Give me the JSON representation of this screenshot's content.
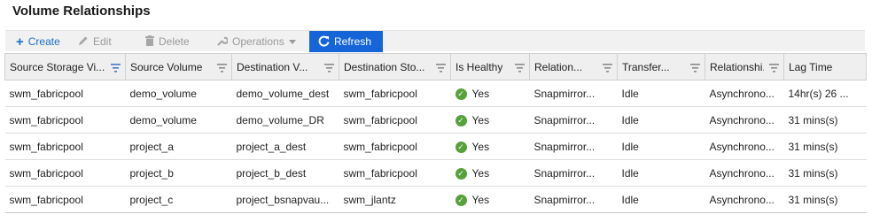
{
  "page": {
    "title": "Volume Relationships"
  },
  "toolbar": {
    "create_label": "Create",
    "edit_label": "Edit",
    "delete_label": "Delete",
    "operations_label": "Operations",
    "refresh_label": "Refresh"
  },
  "table": {
    "columns": [
      "Source Storage Vi...",
      "Source Volume",
      "Destination V...",
      "Destination Sto...",
      "Is Healthy",
      "Relation...",
      "Transfer...",
      "Relationshi...",
      "Lag Time"
    ],
    "rows": [
      [
        "swm_fabricpool",
        "demo_volume",
        "demo_volume_dest",
        "swm_fabricpool",
        "Yes",
        "Snapmirror...",
        "Idle",
        "Asynchrono...",
        "14hr(s) 26 ..."
      ],
      [
        "swm_fabricpool",
        "demo_volume",
        "demo_volume_DR",
        "swm_fabricpool",
        "Yes",
        "Snapmirror...",
        "Idle",
        "Asynchrono...",
        "31 mins(s)"
      ],
      [
        "swm_fabricpool",
        "project_a",
        "project_a_dest",
        "swm_fabricpool",
        "Yes",
        "Snapmirror...",
        "Idle",
        "Asynchrono...",
        "31 mins(s)"
      ],
      [
        "swm_fabricpool",
        "project_b",
        "project_b_dest",
        "swm_fabricpool",
        "Yes",
        "Snapmirror...",
        "Idle",
        "Asynchrono...",
        "31 mins(s)"
      ],
      [
        "swm_fabricpool",
        "project_c",
        "project_bsnapvau...",
        "swm_jlantz",
        "Yes",
        "Snapmirror...",
        "Idle",
        "Asynchrono...",
        "31 mins(s)"
      ]
    ]
  },
  "colors": {
    "accent": "#1565d8",
    "link": "#1e6fc8",
    "healthy": "#57a13b",
    "active_filter": "#4a78c8"
  },
  "icons": {
    "create": "plus-icon",
    "edit": "pencil-icon",
    "delete": "trash-icon",
    "operations": "wrench-icon",
    "refresh": "refresh-icon",
    "filter": "filter-icon",
    "healthy": "check-circle-icon"
  }
}
